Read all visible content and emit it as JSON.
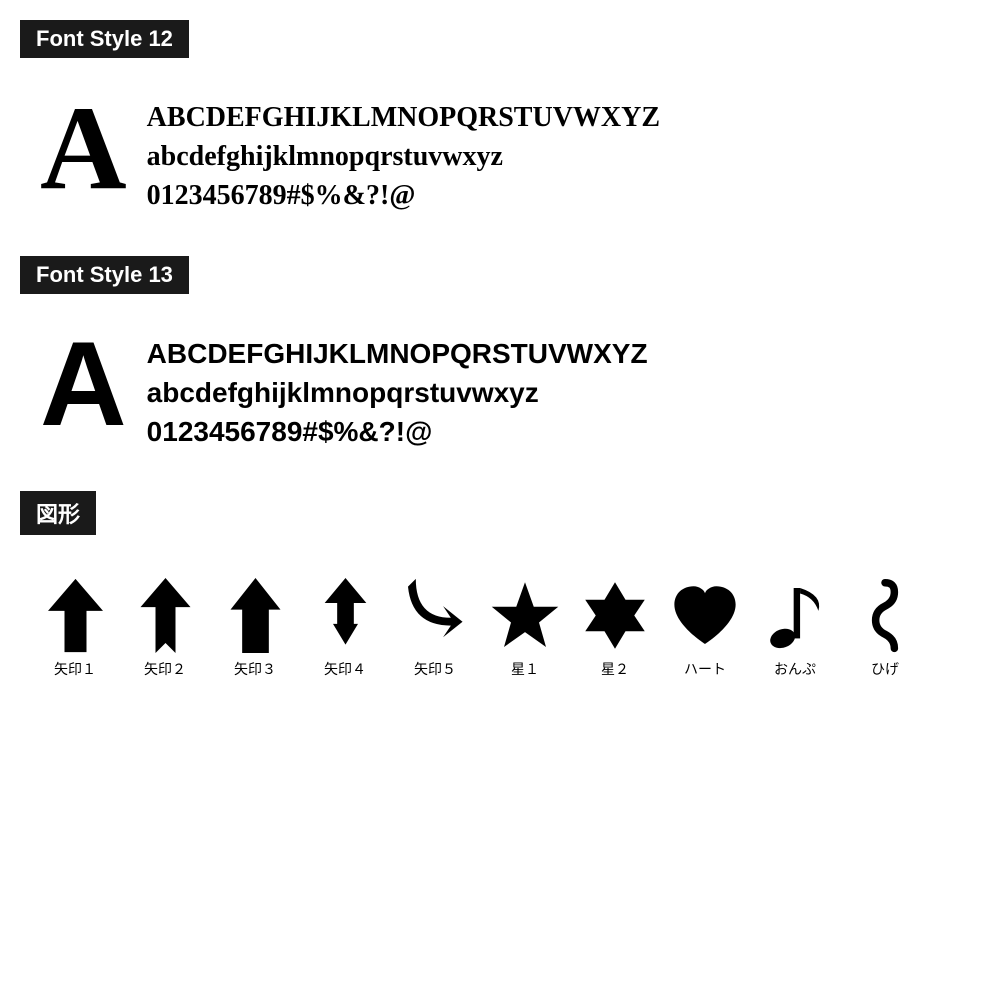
{
  "sections": [
    {
      "id": "font-style-12",
      "label": "Font Style 12",
      "big_letter": "A",
      "lines": [
        "ABCDEFGHIJKLMNOPQRSTUVWXYZ",
        "abcdefghijklmnopqrstuvwxyz",
        "0123456789#$%&?!@"
      ],
      "font_class": "style12"
    },
    {
      "id": "font-style-13",
      "label": "Font Style 13",
      "big_letter": "A",
      "lines": [
        "ABCDEFGHIJKLMNOPQRSTUVWXYZ",
        "abcdefghijklmnopqrstuvwxyz",
        "0123456789#$%&?!@"
      ],
      "font_class": "style13"
    }
  ],
  "shapes_section": {
    "label": "図形",
    "shapes": [
      {
        "id": "yajirushi1",
        "label": "矢印１"
      },
      {
        "id": "yajirushi2",
        "label": "矢印２"
      },
      {
        "id": "yajirushi3",
        "label": "矢印３"
      },
      {
        "id": "yajirushi4",
        "label": "矢印４"
      },
      {
        "id": "yajirushi5",
        "label": "矢印５"
      },
      {
        "id": "hoshi1",
        "label": "星１"
      },
      {
        "id": "hoshi2",
        "label": "星２"
      },
      {
        "id": "heart",
        "label": "ハート"
      },
      {
        "id": "onpu",
        "label": "おんぷ"
      },
      {
        "id": "hige",
        "label": "ひげ"
      }
    ]
  }
}
